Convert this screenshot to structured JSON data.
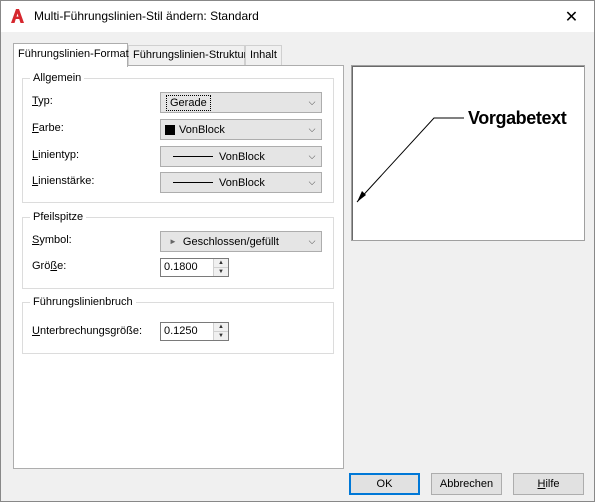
{
  "window": {
    "title": "Multi-Führungslinien-Stil ändern: Standard",
    "close_glyph": "✕",
    "accent_color": "#d6272e"
  },
  "tabs": [
    {
      "label": "Führungslinien-Format",
      "active": true
    },
    {
      "label": "Führungslinien-Struktur",
      "active": false
    },
    {
      "label": "Inhalt",
      "active": false
    }
  ],
  "groups": {
    "allgemein": {
      "legend": "Allgemein",
      "typ": {
        "mnemonic": "T",
        "rest": "yp:",
        "value": "Gerade"
      },
      "farbe": {
        "mnemonic": "F",
        "rest": "arbe:",
        "value": "VonBlock"
      },
      "linientyp": {
        "mnemonic": "L",
        "rest": "inientyp:",
        "value": "VonBlock"
      },
      "linienstaerke": {
        "mnemonic": "L",
        "rest": "inienstärke:",
        "value": "VonBlock"
      }
    },
    "pfeilspitze": {
      "legend": "Pfeilspitze",
      "symbol": {
        "mnemonic": "S",
        "rest": "ymbol:",
        "value": "Geschlossen/gefüllt"
      },
      "groesse": {
        "before": "Grö",
        "mnemonic": "ß",
        "rest": "e:",
        "value": "0.1800"
      }
    },
    "bruch": {
      "legend": "Führungslinienbruch",
      "unterbrechung": {
        "mnemonic": "U",
        "rest": "nterbrechungsgröße:",
        "value": "0.1250"
      }
    }
  },
  "preview": {
    "text": "Vorgabetext"
  },
  "buttons": {
    "ok": "OK",
    "cancel": "Abbrechen",
    "help_mnemonic": "H",
    "help_rest": "ilfe"
  }
}
